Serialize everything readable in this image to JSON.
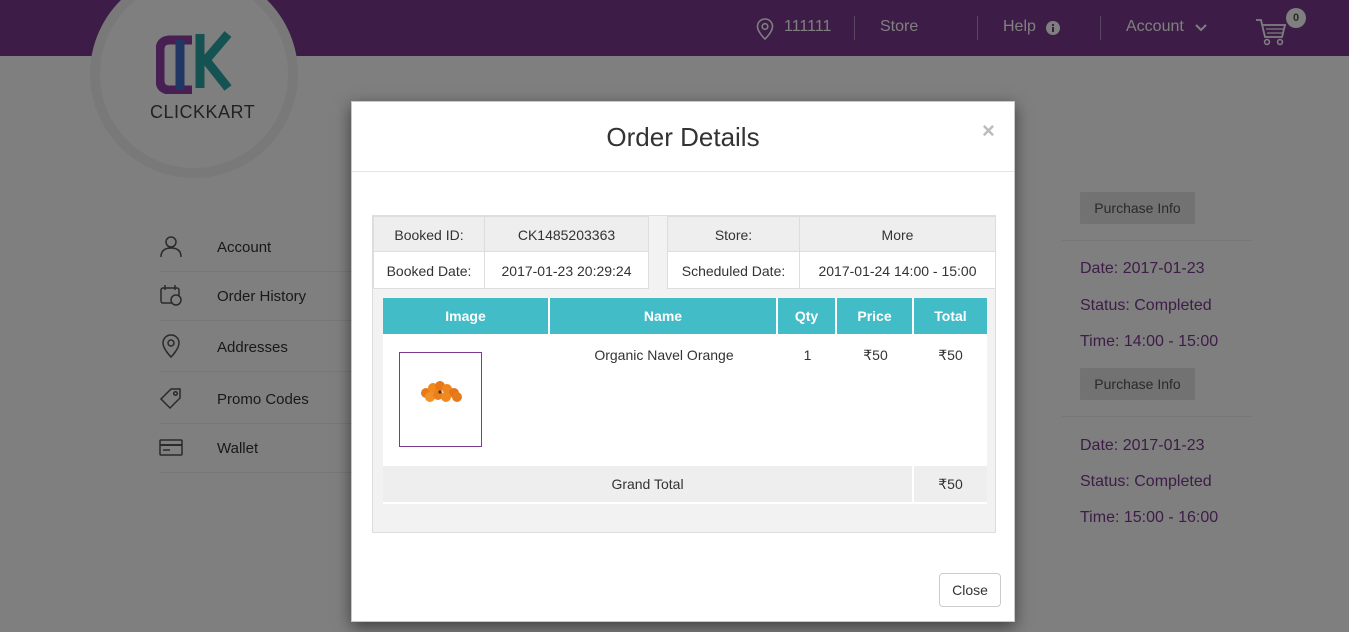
{
  "header": {
    "pincode": "111111",
    "store_label": "Store",
    "help_label": "Help",
    "account_label": "Account",
    "cart_count": "0"
  },
  "logo": {
    "text": "CLICKKART"
  },
  "sidebar": {
    "items": [
      {
        "label": "Account"
      },
      {
        "label": "Order History"
      },
      {
        "label": "Addresses"
      },
      {
        "label": "Promo Codes"
      },
      {
        "label": "Wallet"
      }
    ]
  },
  "orders_panel": {
    "purchase_info_label": "Purchase Info",
    "orders": [
      {
        "date": "Date: 2017-01-23",
        "status": "Status: Completed",
        "time": "Time: 14:00 - 15:00"
      },
      {
        "date": "Date: 2017-01-23",
        "status": "Status: Completed",
        "time": "Time: 15:00 - 16:00"
      }
    ]
  },
  "modal": {
    "title": "Order Details",
    "close_symbol": "×",
    "booked_id_label": "Booked ID:",
    "booked_id": "CK1485203363",
    "store_label": "Store:",
    "store_value": "More",
    "booked_date_label": "Booked Date:",
    "booked_date": "2017-01-23 20:29:24",
    "scheduled_date_label": "Scheduled Date:",
    "scheduled_date": "2017-01-24 14:00 - 15:00",
    "columns": [
      "Image",
      "Name",
      "Qty",
      "Price",
      "Total"
    ],
    "items": [
      {
        "name": "Organic Navel Orange",
        "qty": "1",
        "price": "₹50",
        "total": "₹50"
      }
    ],
    "grand_total_label": "Grand Total",
    "grand_total": "₹50",
    "close_button_label": "Close"
  },
  "colors": {
    "header_purple": "#7b3b8f",
    "table_header_teal": "#42bcc7"
  }
}
